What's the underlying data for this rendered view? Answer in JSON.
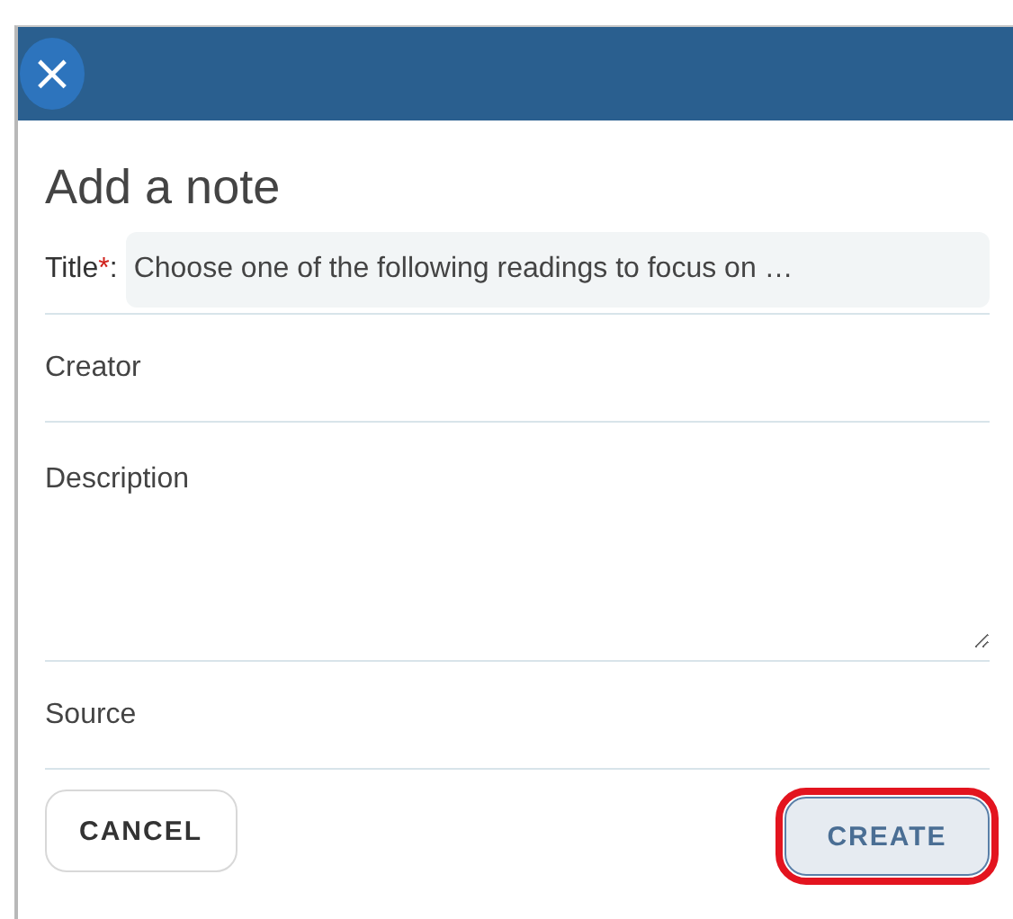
{
  "header": {
    "close_icon": "×"
  },
  "heading": "Add a note",
  "fields": [
    {
      "kind": "inline",
      "label": "Title",
      "required_mark": "*",
      "suffix": ":",
      "value": "Choose one of the following readings to focus on …"
    },
    {
      "kind": "text",
      "placeholder": "Creator"
    },
    {
      "kind": "textarea",
      "placeholder": "Description"
    },
    {
      "kind": "text",
      "placeholder": "Source"
    }
  ],
  "buttons": [
    {
      "label": "CANCEL",
      "kind": "secondary",
      "highlighted": false
    },
    {
      "label": "CREATE",
      "kind": "primary",
      "highlighted": true
    }
  ]
}
